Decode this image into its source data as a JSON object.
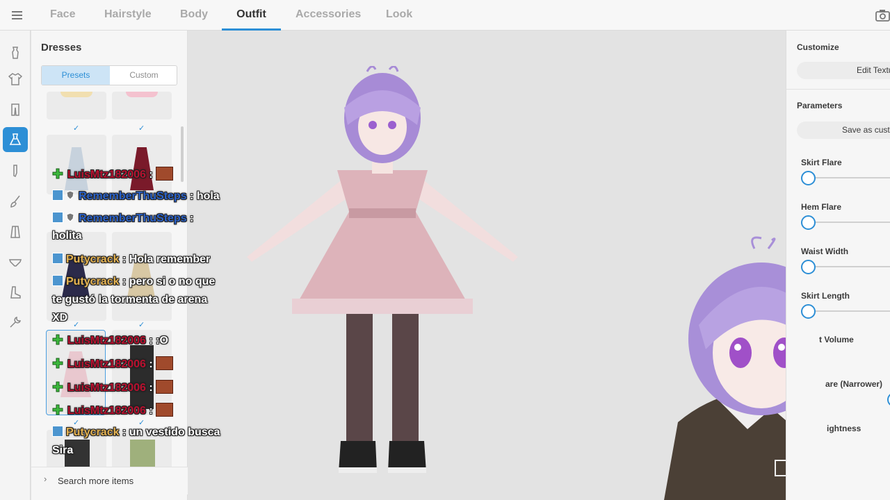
{
  "tabs": [
    "Face",
    "Hairstyle",
    "Body",
    "Outfit",
    "Accessories",
    "Look"
  ],
  "active_tab": "Outfit",
  "left_panel": {
    "title": "Dresses",
    "segments": [
      "Presets",
      "Custom"
    ],
    "active_segment": "Presets",
    "search_more": "Search more items"
  },
  "right_panel": {
    "customize_heading": "Customize",
    "edit_texture_button": "Edit Texture",
    "parameters_heading": "Parameters",
    "save_custom_button": "Save as custom",
    "parameters": [
      {
        "label": "Skirt Flare",
        "value": 0
      },
      {
        "label": "Hem Flare",
        "value": 0
      },
      {
        "label": "Waist Width",
        "value": 0
      },
      {
        "label": "Skirt Length",
        "value": 0
      },
      {
        "label": "t Volume",
        "value": 0
      },
      {
        "label": "are (Narrower)",
        "value": 0
      },
      {
        "label": "ightness",
        "value": 0
      }
    ]
  },
  "chat": [
    {
      "user": "LuisMtz182006",
      "color": "red",
      "badge": "plus",
      "text": " :",
      "emote": true
    },
    {
      "user": "RememberThuSteps",
      "color": "blue",
      "badge": "box-shield",
      "text": " : hola"
    },
    {
      "user": "RememberThuSteps",
      "color": "blue",
      "badge": "box-shield",
      "text": " :"
    },
    {
      "user": "",
      "color": "none",
      "badge": "none",
      "text": "holita"
    },
    {
      "user": "Putycrack",
      "color": "gold",
      "badge": "box",
      "text": " : Hola remember"
    },
    {
      "user": "Putycrack",
      "color": "gold",
      "badge": "box",
      "text": " : pero si o no que"
    },
    {
      "user": "",
      "color": "none",
      "badge": "none",
      "text": "te gustó la tormenta de arena"
    },
    {
      "user": "",
      "color": "none",
      "badge": "none",
      "text": "XD"
    },
    {
      "user": "LuisMtz182006",
      "color": "red",
      "badge": "plus",
      "text": " : :O"
    },
    {
      "user": "LuisMtz182006",
      "color": "red",
      "badge": "plus",
      "text": " :",
      "emote": true
    },
    {
      "user": "LuisMtz182006",
      "color": "red",
      "badge": "plus",
      "text": " :",
      "emote": true
    },
    {
      "user": "LuisMtz182006",
      "color": "red",
      "badge": "plus",
      "text": " :",
      "emote": true
    },
    {
      "user": "Putycrack",
      "color": "gold",
      "badge": "box",
      "text": " : un vestido busca"
    },
    {
      "user": "",
      "color": "none",
      "badge": "none",
      "text": "Sira"
    }
  ],
  "icons": [
    "menu-icon",
    "camera-icon",
    "costume-icon",
    "shirt-icon",
    "pants-icon",
    "dress-icon",
    "sock-icon",
    "brush-icon",
    "coat-icon",
    "underwear-icon",
    "shoe-icon",
    "wrench-icon"
  ],
  "colors": {
    "accent": "#2d8fd6",
    "dress": "#ddb3ba",
    "hair": "#a78bd6"
  }
}
